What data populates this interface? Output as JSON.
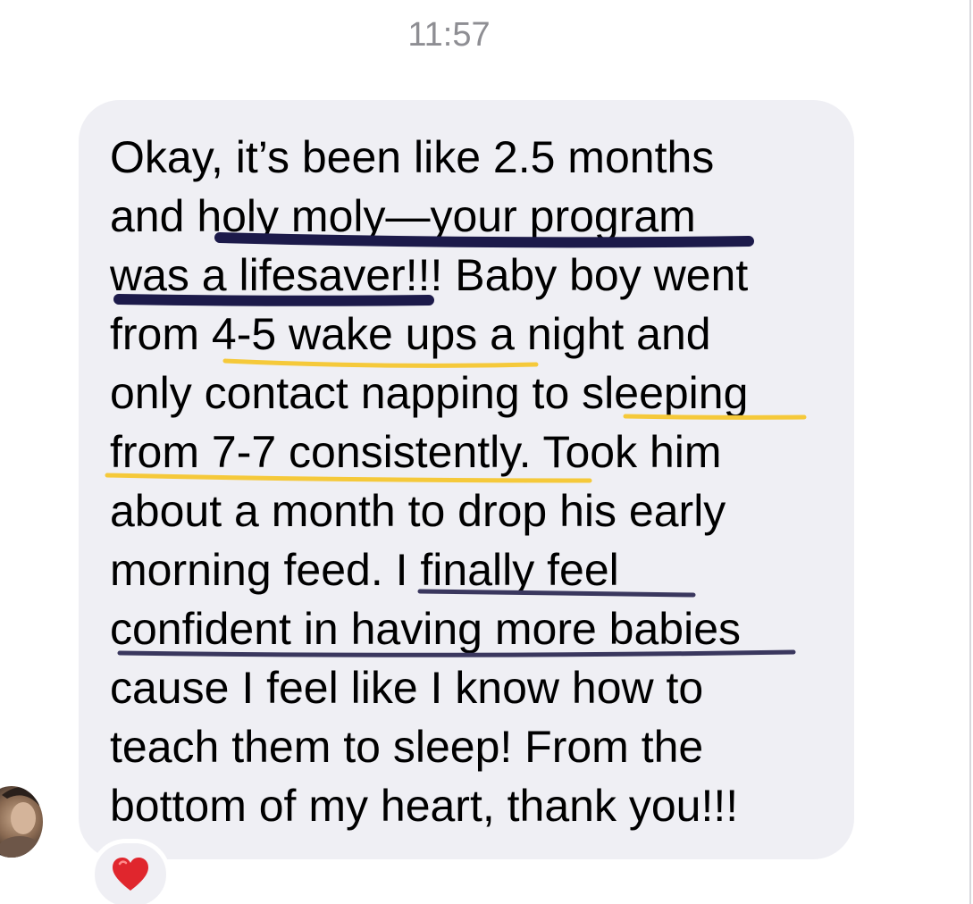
{
  "thread": {
    "timestamp": "11:57"
  },
  "message": {
    "lines": [
      "Okay, it’s been like 2.5 months",
      "and holy moly—your program",
      "was a lifesaver!!! Baby boy went",
      "from 4-5 wake ups a night and",
      "only contact napping to sleeping",
      "from 7-7 consistently. Took him",
      "about a month to drop his early",
      "morning feed. I finally feel",
      "confident in having more babies",
      "cause I feel like I know how to",
      "teach them to sleep! From the",
      "bottom of my heart, thank you!!!"
    ],
    "reaction": "heart-reaction-icon",
    "highlight_colors": {
      "navy": "#1c1a4a",
      "yellow": "#f5c93a"
    }
  },
  "sender": {
    "avatar": "avatar-photo"
  },
  "colors": {
    "bubble": "#efeff4",
    "timestamp": "#8e8e93",
    "text": "#000000",
    "heart": "#e0262d"
  }
}
